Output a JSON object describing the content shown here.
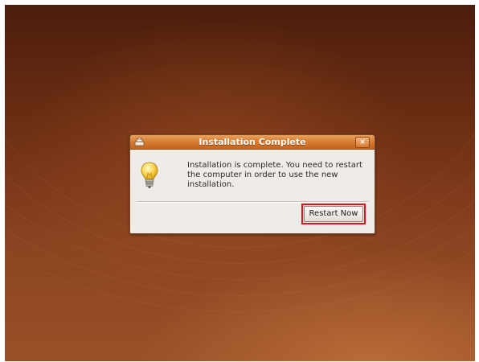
{
  "dialog": {
    "title": "Installation Complete",
    "close_label": "×",
    "icon": "lightbulb-icon",
    "message": "Installation is complete. You need to restart the computer in order to use the new installation.",
    "restart_button_label": "Restart Now"
  },
  "colors": {
    "titlebar": "#d67c32",
    "dialog_background": "#efebe7",
    "highlight": "#d9141c",
    "desktop": "#6e2f14"
  }
}
